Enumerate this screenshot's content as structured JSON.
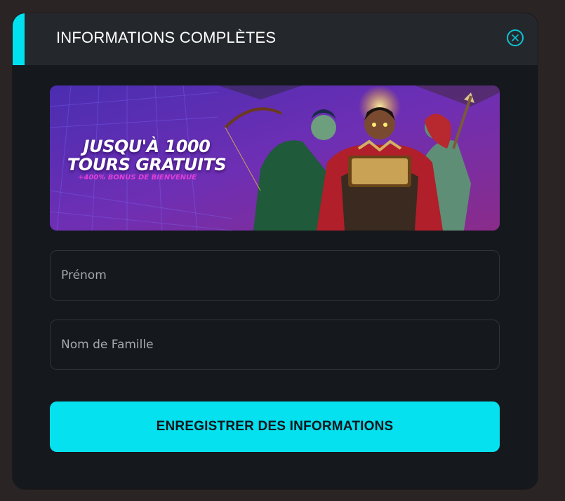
{
  "modal": {
    "title": "INFORMATIONS COMPLÈTES",
    "close_icon": "close-icon"
  },
  "banner": {
    "headline_line1": "JUSQU'À 1000",
    "headline_line2": "TOURS GRATUITS",
    "subline": "+400% BONUS DE BIENVENUE"
  },
  "form": {
    "first_name_placeholder": "Prénom",
    "first_name_value": "",
    "last_name_placeholder": "Nom de Famille",
    "last_name_value": "",
    "submit_label": "ENREGISTRER DES INFORMATIONS"
  },
  "colors": {
    "accent": "#00e1f0",
    "background": "#15181d",
    "header": "#24282d"
  }
}
